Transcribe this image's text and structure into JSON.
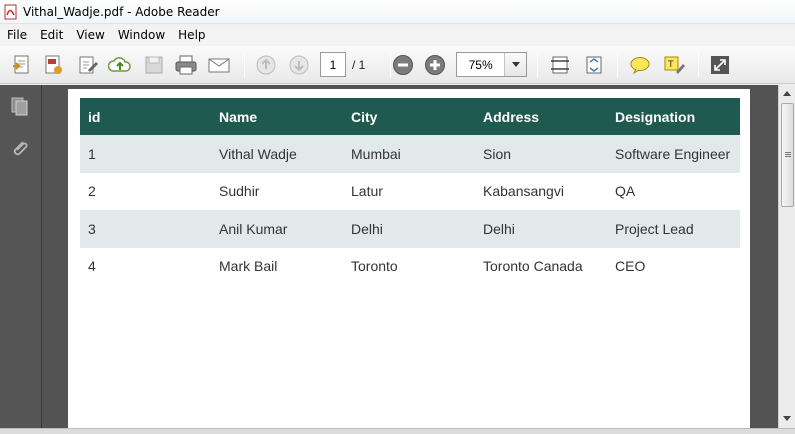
{
  "window": {
    "title": "Vithal_Wadje.pdf - Adobe Reader"
  },
  "menu": {
    "items": [
      "File",
      "Edit",
      "View",
      "Window",
      "Help"
    ]
  },
  "toolbar": {
    "page_current": "1",
    "page_total": "/ 1",
    "zoom": "75%",
    "icons": [
      "create-pdf-icon",
      "convert-pdf-icon",
      "edit-icon",
      "upload-icon",
      "save-icon",
      "print-icon",
      "email-icon",
      "page-up-icon",
      "page-down-icon",
      "zoom-out-icon",
      "zoom-in-icon",
      "fit-page-icon",
      "fit-width-icon",
      "comment-icon",
      "highlight-icon",
      "fullscreen-icon"
    ]
  },
  "nav": {
    "icons": [
      "pages-icon",
      "attachment-icon"
    ]
  },
  "document": {
    "table": {
      "headers": [
        "id",
        "Name",
        "City",
        "Address",
        "Designation"
      ],
      "rows": [
        [
          "1",
          "Vithal Wadje",
          "Mumbai",
          "Sion",
          "Software Engineer"
        ],
        [
          "2",
          "Sudhir",
          "Latur",
          "Kabansangvi",
          "QA"
        ],
        [
          "3",
          "Anil Kumar",
          "Delhi",
          "Delhi",
          "Project Lead"
        ],
        [
          "4",
          "Mark Bail",
          "Toronto",
          "Toronto Canada",
          "CEO"
        ]
      ]
    }
  },
  "colors": {
    "header_bg": "#1f5a50",
    "odd_row_bg": "#e1e9ea",
    "doc_bg": "#535353"
  }
}
